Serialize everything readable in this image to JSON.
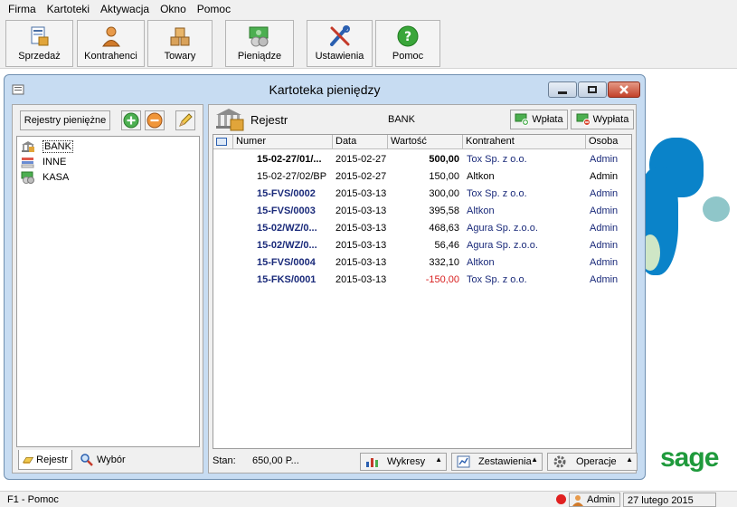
{
  "menu": [
    "Firma",
    "Kartoteki",
    "Aktywacja",
    "Okno",
    "Pomoc"
  ],
  "toolbar": [
    {
      "label": "Sprzedaż",
      "icon": "sales-icon"
    },
    {
      "label": "Kontrahenci",
      "icon": "contractors-icon"
    },
    {
      "label": "Towary",
      "icon": "goods-icon"
    },
    {
      "label": "Pieniądze",
      "icon": "money-icon"
    },
    {
      "label": "Ustawienia",
      "icon": "settings-icon"
    },
    {
      "label": "Pomoc",
      "icon": "help-icon"
    }
  ],
  "window": {
    "title": "Kartoteka pieniędzy"
  },
  "left": {
    "registers_button": "Rejestry pieniężne",
    "tree": [
      {
        "label": "BANK",
        "icon": "bank-icon",
        "selected": true
      },
      {
        "label": "INNE",
        "icon": "other-register-icon"
      },
      {
        "label": "KASA",
        "icon": "cash-register-icon"
      }
    ],
    "tabs": [
      {
        "label": "Rejestr",
        "icon": "register-tab-icon"
      },
      {
        "label": "Wybór",
        "icon": "search-icon"
      }
    ]
  },
  "right": {
    "register_label": "Rejestr",
    "register_value": "BANK",
    "deposit_button": "Wpłata",
    "withdraw_button": "Wypłata",
    "columns": [
      "Numer",
      "Data",
      "Wartość",
      "Kontrahent",
      "Osoba"
    ],
    "rows": [
      {
        "numer": "15-02-27/01/...",
        "data": "2015-02-27",
        "wartosc": "500,00",
        "kontrahent": "Tox Sp. z o.o.",
        "osoba": "Admin",
        "style": "bold"
      },
      {
        "numer": "15-02-27/02/BP",
        "data": "2015-02-27",
        "wartosc": "150,00",
        "kontrahent": "Altkon",
        "osoba": "Admin",
        "style": "normal"
      },
      {
        "numer": "15-FVS/0002",
        "data": "2015-03-13",
        "wartosc": "300,00",
        "kontrahent": "Tox Sp. z o.o.",
        "osoba": "Admin",
        "style": "navy"
      },
      {
        "numer": "15-FVS/0003",
        "data": "2015-03-13",
        "wartosc": "395,58",
        "kontrahent": "Altkon",
        "osoba": "Admin",
        "style": "navy"
      },
      {
        "numer": "15-02/WZ/0...",
        "data": "2015-03-13",
        "wartosc": "468,63",
        "kontrahent": "Agura Sp. z.o.o.",
        "osoba": "Admin",
        "style": "navy"
      },
      {
        "numer": "15-02/WZ/0...",
        "data": "2015-03-13",
        "wartosc": "56,46",
        "kontrahent": "Agura Sp. z.o.o.",
        "osoba": "Admin",
        "style": "navy"
      },
      {
        "numer": "15-FVS/0004",
        "data": "2015-03-13",
        "wartosc": "332,10",
        "kontrahent": "Altkon",
        "osoba": "Admin",
        "style": "navy"
      },
      {
        "numer": "15-FKS/0001",
        "data": "2015-03-13",
        "wartosc": "-150,00",
        "kontrahent": "Tox Sp. z o.o.",
        "osoba": "Admin",
        "style": "navy-red"
      }
    ],
    "stan_label": "Stan:",
    "stan_value": "650,00 P...",
    "charts_button": "Wykresy",
    "reports_button": "Zestawienia",
    "operations_button": "Operacje"
  },
  "brand": "sage",
  "status": {
    "help": "F1 - Pomoc",
    "user": "Admin",
    "date": "27 lutego 2015"
  },
  "colors": {
    "accent_blue": "#0a83c9",
    "brand_green": "#1f9a3c",
    "negative": "#d81e1e"
  }
}
